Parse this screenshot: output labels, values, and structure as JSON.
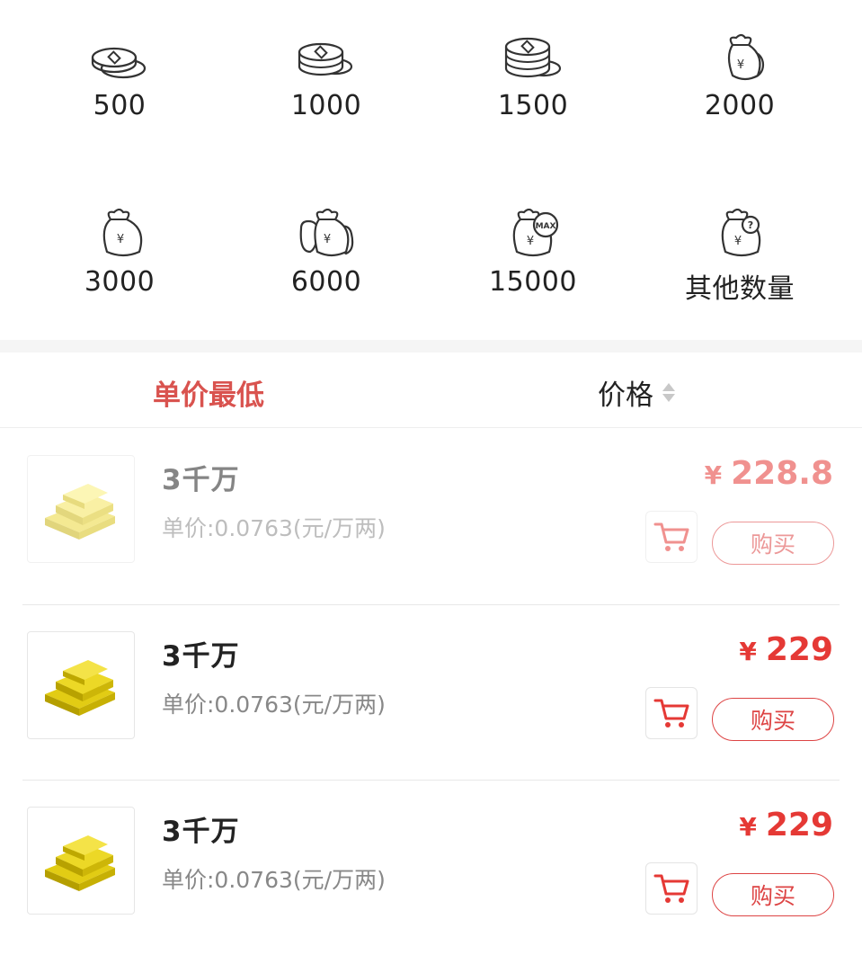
{
  "amounts": [
    {
      "label": "500",
      "icon": "coin-stack-small-icon"
    },
    {
      "label": "1000",
      "icon": "coin-stack-medium-icon"
    },
    {
      "label": "1500",
      "icon": "coin-stack-large-icon"
    },
    {
      "label": "2000",
      "icon": "money-bag-icon"
    },
    {
      "label": "3000",
      "icon": "money-bag-icon"
    },
    {
      "label": "6000",
      "icon": "double-money-bag-icon"
    },
    {
      "label": "15000",
      "icon": "money-bag-max-icon"
    },
    {
      "label": "其他数量",
      "icon": "money-bag-question-icon"
    }
  ],
  "sort": {
    "lowest_label": "单价最低",
    "price_label": "价格"
  },
  "listings": [
    {
      "title": "3千万",
      "unit_price": "单价:0.0763(元/万两)",
      "currency": "¥",
      "price": "228.8",
      "buy_label": "购买",
      "faded": true
    },
    {
      "title": "3千万",
      "unit_price": "单价:0.0763(元/万两)",
      "currency": "¥",
      "price": "229",
      "buy_label": "购买",
      "faded": false
    },
    {
      "title": "3千万",
      "unit_price": "单价:0.0763(元/万两)",
      "currency": "¥",
      "price": "229",
      "buy_label": "购买",
      "faded": false
    }
  ],
  "colors": {
    "accent": "#e53935",
    "sort_active": "#d9534f",
    "gold": "#e5cf1c"
  }
}
